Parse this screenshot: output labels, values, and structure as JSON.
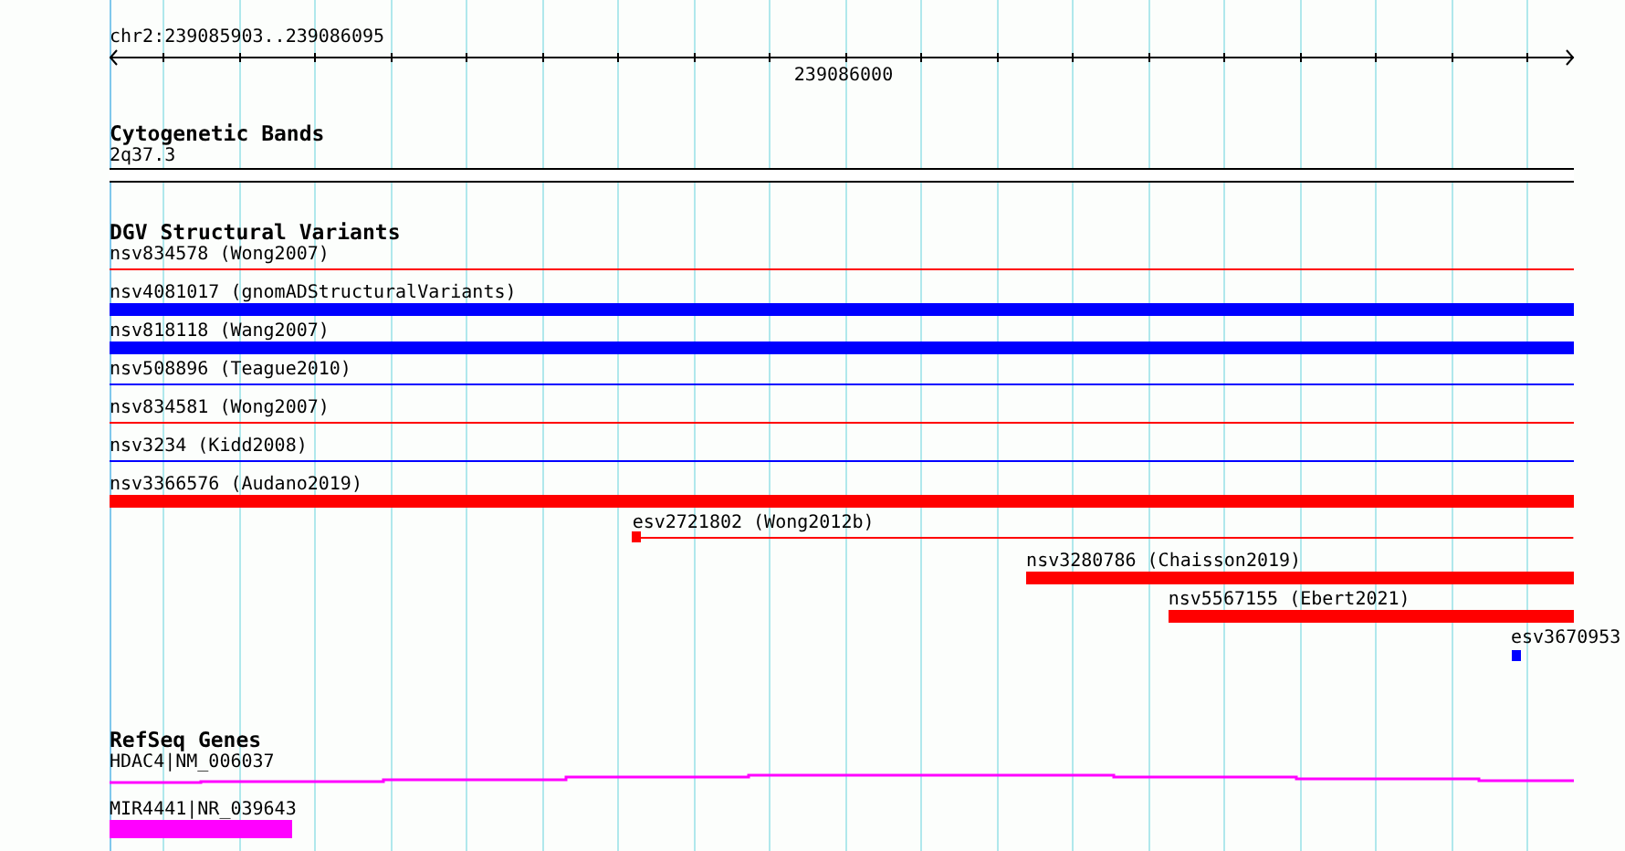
{
  "ruler": {
    "region": "chr2:239085903..239086095",
    "tick_label": "239086000"
  },
  "tracks": [
    {
      "title": "Cytogenetic Bands",
      "features": [
        {
          "label": "2q37.3",
          "kind": "band",
          "color": "#000000"
        }
      ]
    },
    {
      "title": "DGV Structural Variants",
      "features": [
        {
          "label": "nsv834578 (Wong2007)",
          "kind": "thin",
          "color": "#ff0000"
        },
        {
          "label": "nsv4081017 (gnomADStructuralVariants)",
          "kind": "thick",
          "color": "#0000ff"
        },
        {
          "label": "nsv818118 (Wang2007)",
          "kind": "thick",
          "color": "#0000ff"
        },
        {
          "label": "nsv508896 (Teague2010)",
          "kind": "thin",
          "color": "#0000ff"
        },
        {
          "label": "nsv834581 (Wong2007)",
          "kind": "thin",
          "color": "#ff0000"
        },
        {
          "label": "nsv3234 (Kidd2008)",
          "kind": "thin",
          "color": "#0000ff"
        },
        {
          "label": "nsv3366576 (Audano2019)",
          "kind": "thick",
          "color": "#ff0000"
        },
        {
          "label": "esv2721802 (Wong2012b)",
          "kind": "marked",
          "color": "#ff0000"
        },
        {
          "label": "nsv3280786 (Chaisson2019)",
          "kind": "thick",
          "color": "#ff0000"
        },
        {
          "label": "nsv5567155 (Ebert2021)",
          "kind": "thick",
          "color": "#ff0000"
        },
        {
          "label": "esv3670953",
          "kind": "point",
          "color": "#0000ff"
        }
      ]
    },
    {
      "title": "RefSeq Genes",
      "features": [
        {
          "label": "HDAC4|NM_006037",
          "kind": "intron",
          "color": "#ff00ff"
        },
        {
          "label": "MIR4441|NR_039643",
          "kind": "exon",
          "color": "#ff00ff"
        }
      ]
    }
  ]
}
